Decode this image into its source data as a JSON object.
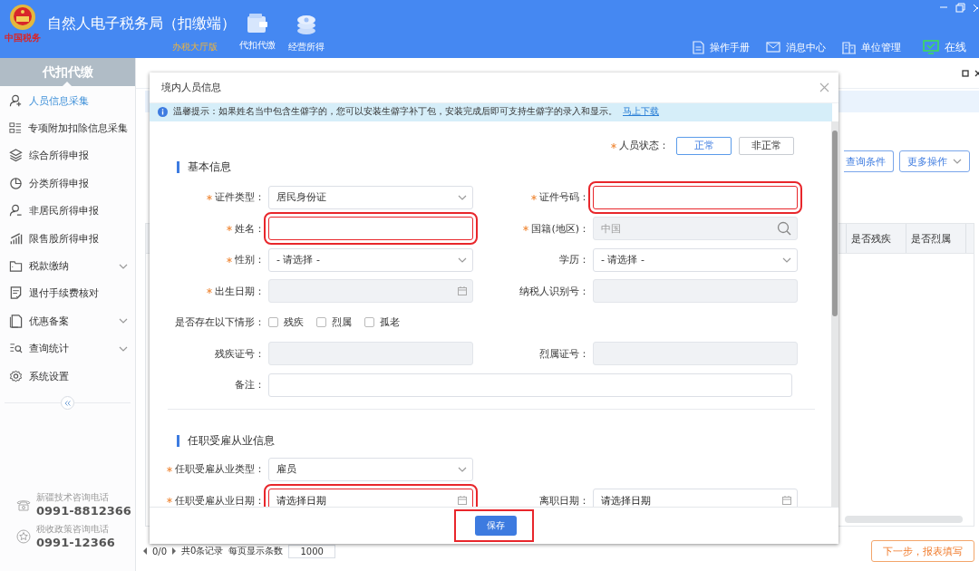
{
  "header": {
    "logo_text": "中国税务",
    "title": "自然人电子税务局（扣缴端）",
    "edition": "办税大厅版",
    "nav": [
      {
        "label": "代扣代缴"
      },
      {
        "label": "经营所得"
      }
    ],
    "tools": [
      {
        "label": "操作手册"
      },
      {
        "label": "消息中心"
      },
      {
        "label": "单位管理"
      },
      {
        "label": "在线"
      }
    ]
  },
  "sidebar": {
    "title": "代扣代缴",
    "items": [
      {
        "label": "人员信息采集",
        "selected": true,
        "expandable": false
      },
      {
        "label": "专项附加扣除信息采集",
        "selected": false,
        "expandable": false
      },
      {
        "label": "综合所得申报",
        "selected": false,
        "expandable": false
      },
      {
        "label": "分类所得申报",
        "selected": false,
        "expandable": false
      },
      {
        "label": "非居民所得申报",
        "selected": false,
        "expandable": false
      },
      {
        "label": "限售股所得申报",
        "selected": false,
        "expandable": false
      },
      {
        "label": "税款缴纳",
        "selected": false,
        "expandable": true
      },
      {
        "label": "退付手续费核对",
        "selected": false,
        "expandable": false
      },
      {
        "label": "优惠备案",
        "selected": false,
        "expandable": true
      },
      {
        "label": "查询统计",
        "selected": false,
        "expandable": true
      },
      {
        "label": "系统设置",
        "selected": false,
        "expandable": false
      }
    ],
    "hotlines": [
      {
        "caption": "新疆技术咨询电话",
        "number": "0991-8812366"
      },
      {
        "caption": "税收政策咨询电话",
        "number": "0991-12366"
      }
    ]
  },
  "main": {
    "toolbar": [
      {
        "label": "查询条件",
        "kind": "plain"
      },
      {
        "label": "更多操作",
        "kind": "dropdown"
      }
    ],
    "columns": [
      "是否残疾",
      "是否烈属"
    ],
    "pager": {
      "pages": "0/0",
      "total": "共0条记录",
      "page_size_label": "每页显示条数",
      "page_size": "1000"
    },
    "next_button": "下一步，报表填写"
  },
  "dialog": {
    "title": "境内人员信息",
    "notice": {
      "text": "温馨提示：如果姓名当中包含生僻字的，您可以安装生僻字补丁包，安装完成后即可支持生僻字的录入和显示。",
      "link": "马上下载"
    },
    "status": {
      "label": "人员状态：",
      "required": true,
      "options": [
        {
          "label": "正常",
          "selected": true
        },
        {
          "label": "非正常",
          "selected": false
        }
      ]
    },
    "sections": [
      {
        "title": "基本信息",
        "rows": [
          [
            {
              "label": "证件类型：",
              "required": true,
              "kind": "select",
              "value": "居民身份证",
              "disabled": false,
              "highlighted": false
            },
            {
              "label": "证件号码：",
              "required": true,
              "kind": "text",
              "disabled": false,
              "highlighted": true
            }
          ],
          [
            {
              "label": "姓名：",
              "required": true,
              "kind": "text",
              "disabled": false,
              "highlighted": true
            },
            {
              "label": "国籍(地区)：",
              "required": true,
              "kind": "search",
              "value": "中国",
              "disabled": true,
              "highlighted": false
            }
          ],
          [
            {
              "label": "性别：",
              "required": true,
              "kind": "select",
              "value": "- 请选择 -",
              "disabled": false,
              "highlighted": false
            },
            {
              "label": "学历：",
              "required": false,
              "kind": "select",
              "value": "- 请选择 -",
              "disabled": false,
              "highlighted": false
            }
          ],
          [
            {
              "label": "出生日期：",
              "required": true,
              "kind": "date",
              "disabled": true,
              "highlighted": false
            },
            {
              "label": "纳税人识别号：",
              "required": false,
              "kind": "text",
              "disabled": true,
              "highlighted": false
            }
          ],
          [
            {
              "label": "是否存在以下情形：",
              "required": false,
              "kind": "checks",
              "options": [
                {
                  "label": "残疾",
                  "checked": false
                },
                {
                  "label": "烈属",
                  "checked": false
                },
                {
                  "label": "孤老",
                  "checked": false
                }
              ]
            }
          ],
          [
            {
              "label": "残疾证号：",
              "required": false,
              "kind": "text",
              "disabled": true,
              "highlighted": false
            },
            {
              "label": "烈属证号：",
              "required": false,
              "kind": "text",
              "disabled": true,
              "highlighted": false
            }
          ],
          [
            {
              "label": "备注：",
              "required": false,
              "kind": "wide",
              "disabled": false,
              "highlighted": false
            }
          ]
        ]
      },
      {
        "title": "任职受雇从业信息",
        "rows": [
          [
            {
              "label": "任职受雇从业类型：",
              "required": true,
              "kind": "select",
              "value": "雇员",
              "disabled": false,
              "highlighted": false
            }
          ],
          [
            {
              "label": "任职受雇从业日期：",
              "required": true,
              "kind": "date",
              "placeholder": "请选择日期",
              "disabled": false,
              "highlighted": true
            },
            {
              "label": "离职日期：",
              "required": false,
              "kind": "date",
              "placeholder": "请选择日期",
              "disabled": false,
              "highlighted": false
            }
          ]
        ]
      }
    ],
    "save": {
      "label": "保存",
      "highlighted": true
    }
  }
}
